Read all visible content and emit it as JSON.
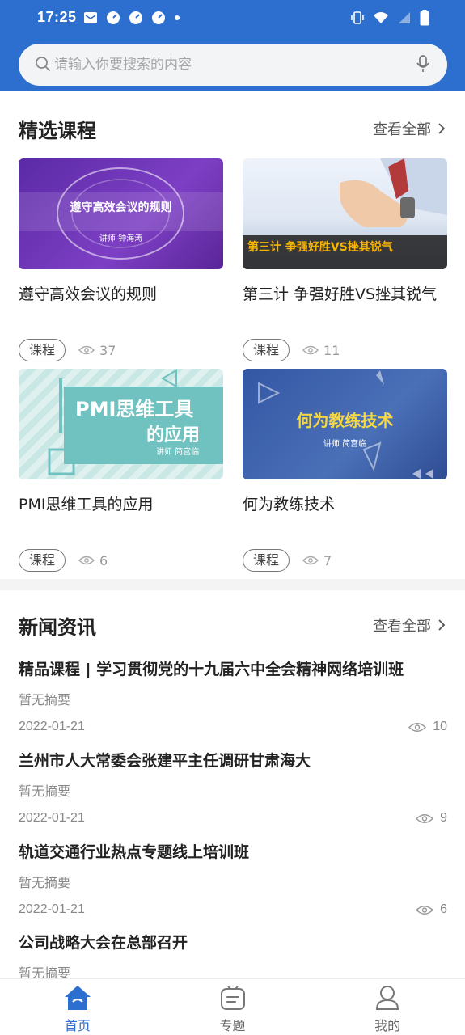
{
  "status_bar": {
    "time": "17:25",
    "battery": "battery-icon"
  },
  "search": {
    "placeholder": "请输入你要搜索的内容"
  },
  "featured": {
    "title": "精选课程",
    "see_all": "查看全部",
    "courses": [
      {
        "title": "遵守高效会议的规则",
        "thumb_title": "遵守高效会议的规则",
        "thumb_sub": "讲师 钟海涛",
        "tag": "课程",
        "views": "37"
      },
      {
        "title": "第三计 争强好胜VS挫其锐气",
        "thumb_title": "第三计 争强好胜VS挫其锐气",
        "tag": "课程",
        "views": "11"
      },
      {
        "title": "PMI思维工具的应用",
        "thumb_title_1": "PMI思维工具",
        "thumb_title_2": "的应用",
        "thumb_sub": "讲师 简宫临",
        "tag": "课程",
        "views": "6"
      },
      {
        "title": "何为教练技术",
        "thumb_title": "何为教练技术",
        "thumb_sub": "讲师 简宫临",
        "tag": "课程",
        "views": "7"
      }
    ]
  },
  "news": {
    "title": "新闻资讯",
    "see_all": "查看全部",
    "items": [
      {
        "title": "精品课程 | 学习贯彻党的十九届六中全会精神网络培训班",
        "summary": "暂无摘要",
        "date": "2022-01-21",
        "views": "10"
      },
      {
        "title": "兰州市人大常委会张建平主任调研甘肃海大",
        "summary": "暂无摘要",
        "date": "2022-01-21",
        "views": "9"
      },
      {
        "title": "轨道交通行业热点专题线上培训班",
        "summary": "暂无摘要",
        "date": "2022-01-21",
        "views": "6"
      },
      {
        "title": "公司战略大会在总部召开",
        "summary": "暂无摘要"
      }
    ]
  },
  "tabbar": {
    "items": [
      {
        "label": "首页",
        "icon": "home-icon",
        "active": true
      },
      {
        "label": "专题",
        "icon": "topic-icon",
        "active": false
      },
      {
        "label": "我的",
        "icon": "profile-icon",
        "active": false
      }
    ]
  },
  "colors": {
    "primary": "#2d6fcf",
    "card_purple": "#6a2fb0",
    "card_teal": "#6fc2c0",
    "card_blue": "#3a5ea8"
  }
}
